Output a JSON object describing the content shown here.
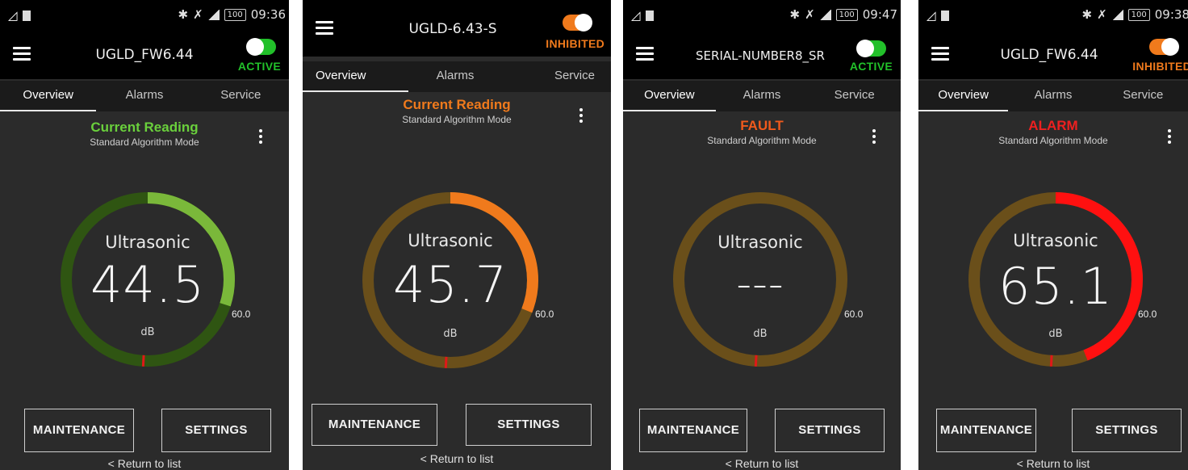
{
  "screens": [
    {
      "status_bar": {
        "time": "09:36",
        "battery": "100"
      },
      "device_name": "UGLD_FW6.44",
      "toggle": {
        "state": "ACTIVE",
        "color": "#22c02a",
        "on": false
      },
      "tabs": [
        "Overview",
        "Alarms",
        "Service"
      ],
      "active_tab": "Overview",
      "status": {
        "label": "Current Reading",
        "color": "#6ad03c"
      },
      "mode": "Standard Algorithm Mode",
      "gauge": {
        "title": "Ultrasonic",
        "value": "44.5",
        "unit": "dB",
        "limit_label": "60.0",
        "level_fraction": 0.3,
        "fill_color": "#7ab83a",
        "track_color": "#2f5512"
      },
      "buttons": {
        "maintenance": "MAINTENANCE",
        "settings": "SETTINGS"
      },
      "return_link": "< Return to list"
    },
    {
      "status_bar": {
        "time": "",
        "battery": ""
      },
      "device_name": "UGLD-6.43-S",
      "toggle": {
        "state": "INHIBITED",
        "color": "#f07a1c",
        "on": true
      },
      "tabs": [
        "Overview",
        "Alarms",
        "Service"
      ],
      "active_tab": "Overview",
      "status": {
        "label": "Current Reading",
        "color": "#f07a1c"
      },
      "mode": "Standard Algorithm Mode",
      "gauge": {
        "title": "Ultrasonic",
        "value": "45.7",
        "unit": "dB",
        "limit_label": "60.0",
        "level_fraction": 0.31,
        "fill_color": "#f07a1c",
        "track_color": "#6a4f1a"
      },
      "buttons": {
        "maintenance": "MAINTENANCE",
        "settings": "SETTINGS"
      },
      "return_link": "< Return to list"
    },
    {
      "status_bar": {
        "time": "09:47",
        "battery": "100"
      },
      "device_name": "SERIAL-NUMBER8_SR",
      "toggle": {
        "state": "ACTIVE",
        "color": "#22c02a",
        "on": false
      },
      "tabs": [
        "Overview",
        "Alarms",
        "Service"
      ],
      "active_tab": "Overview",
      "status": {
        "label": "FAULT",
        "color": "#f05a1c"
      },
      "mode": "Standard Algorithm Mode",
      "gauge": {
        "title": "Ultrasonic",
        "value": "---",
        "unit": "dB",
        "limit_label": "60.0",
        "level_fraction": 0,
        "fill_color": "#6a4f1a",
        "track_color": "#6a4f1a"
      },
      "buttons": {
        "maintenance": "MAINTENANCE",
        "settings": "SETTINGS"
      },
      "return_link": "< Return to list"
    },
    {
      "status_bar": {
        "time": "09:38",
        "battery": "100"
      },
      "device_name": "UGLD_FW6.44",
      "toggle": {
        "state": "INHIBITED",
        "color": "#f07a1c",
        "on": true
      },
      "tabs": [
        "Overview",
        "Alarms",
        "Service"
      ],
      "active_tab": "Overview",
      "status": {
        "label": "ALARM",
        "color": "#ee2020"
      },
      "mode": "Standard Algorithm Mode",
      "gauge": {
        "title": "Ultrasonic",
        "value": "65.1",
        "unit": "dB",
        "limit_label": "60.0",
        "level_fraction": 0.44,
        "fill_color": "#ff1010",
        "track_color": "#6a4f1a"
      },
      "buttons": {
        "maintenance": "MAINTENANCE",
        "settings": "SETTINGS"
      },
      "return_link": "< Return to list"
    }
  ]
}
